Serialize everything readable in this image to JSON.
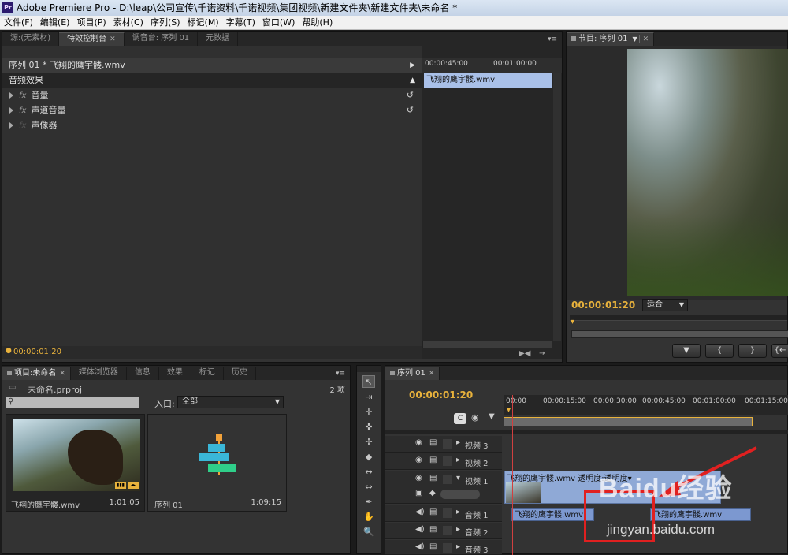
{
  "window": {
    "title": "Adobe Premiere Pro - D:\\leap\\公司宣传\\千诺资料\\千诺视频\\集团视频\\新建文件夹\\新建文件夹\\未命名 *",
    "app_icon": "Pr"
  },
  "menu": [
    "文件(F)",
    "编辑(E)",
    "项目(P)",
    "素材(C)",
    "序列(S)",
    "标记(M)",
    "字幕(T)",
    "窗口(W)",
    "帮助(H)"
  ],
  "source_panel": {
    "tabs": [
      "源:(无素材)",
      "特效控制台",
      "调音台: 序列 01",
      "元数据"
    ],
    "sequence_clip": "序列 01 * 飞翔的鹰宇髅.wmv",
    "ruler": [
      "00:00:45:00",
      "00:01:00:00"
    ],
    "clip_name": "飞翔的鹰宇髅.wmv",
    "section_title": "音频效果",
    "effects": [
      {
        "label": "音量",
        "fx": "fx"
      },
      {
        "label": "声道音量",
        "fx": "fx"
      },
      {
        "label": "声像器",
        "fx": "fx"
      }
    ],
    "timecode": "00:00:01:20"
  },
  "program_panel": {
    "tab": "节目: 序列 01",
    "timecode": "00:00:01:20",
    "fit": "适合",
    "buttons": [
      "▼",
      "{",
      "}",
      "{←"
    ]
  },
  "project_panel": {
    "tabs": [
      "项目:未命名",
      "媒体浏览器",
      "信息",
      "效果",
      "标记",
      "历史"
    ],
    "project_file": "未命名.prproj",
    "item_count": "2 项",
    "search_placeholder": "",
    "in_label": "入口:",
    "in_value": "全部",
    "items": [
      {
        "name": "飞翔的鹰宇髅.wmv",
        "duration": "1:01:05"
      },
      {
        "name": "序列 01",
        "duration": "1:09:15"
      }
    ]
  },
  "timeline_panel": {
    "tab": "序列 01",
    "timecode": "00:00:01:20",
    "ruler": [
      "00:00",
      "00:00:15:00",
      "00:00:30:00",
      "00:00:45:00",
      "00:01:00:00",
      "00:01:15:00"
    ],
    "video_tracks": [
      "视频 3",
      "视频 2",
      "视频 1"
    ],
    "audio_tracks": [
      "音频 1",
      "音频 2",
      "音频 3"
    ],
    "video_clip": "飞翔的鹰宇髅.wmv 透明度:透明度▾",
    "audio_clip1": "飞翔的鹰宇髅.wmv",
    "audio_clip2": "飞翔的鹰宇髅.wmv"
  },
  "watermark": {
    "brand": "Baidu经验",
    "url": "jingyan.baidu.com"
  },
  "colors": {
    "accent": "#e8b23c",
    "clip_video": "#9fb8e0",
    "clip_audio": "#7c98d0",
    "highlight_box": "#e02020"
  }
}
